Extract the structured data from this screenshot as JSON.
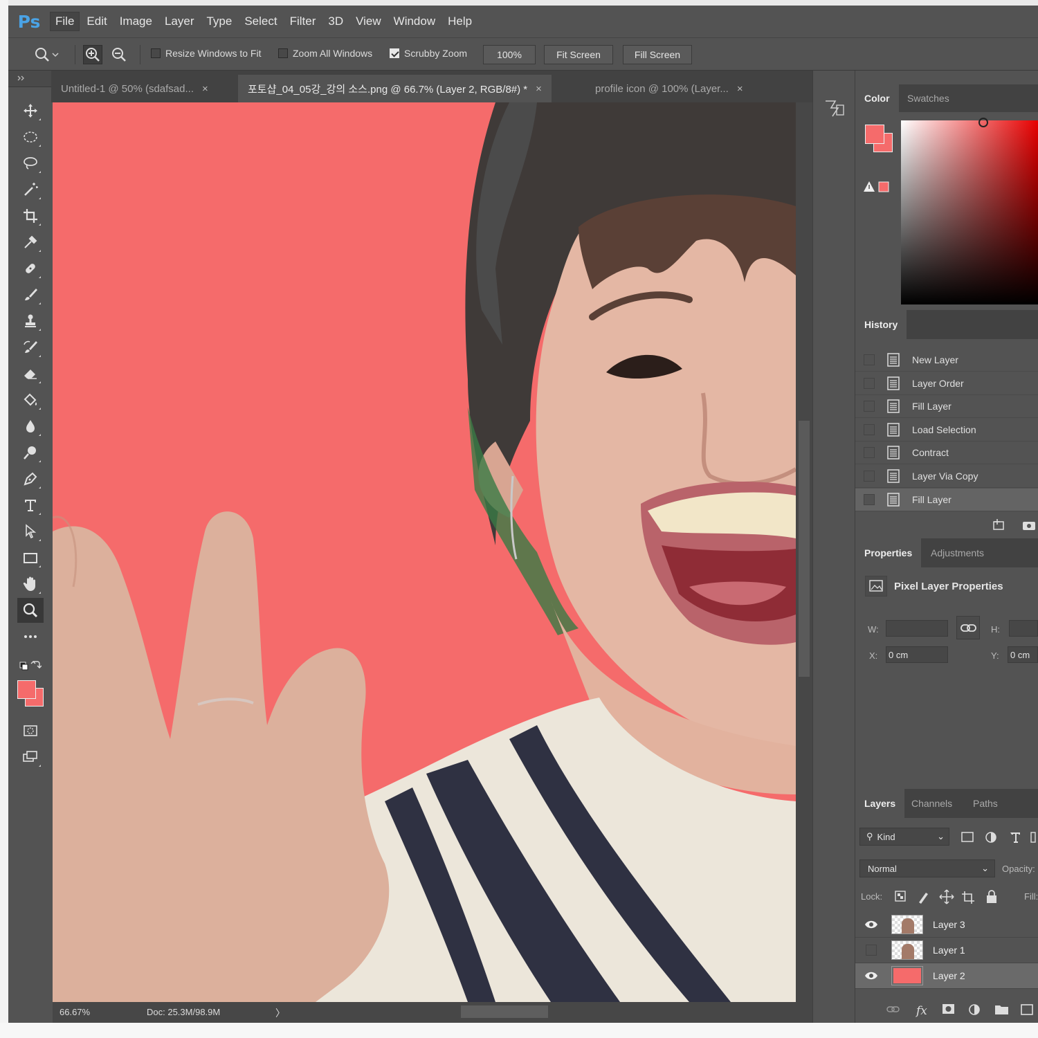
{
  "app": {
    "logo": "Ps"
  },
  "menu": [
    "File",
    "Edit",
    "Image",
    "Layer",
    "Type",
    "Select",
    "Filter",
    "3D",
    "View",
    "Window",
    "Help"
  ],
  "options": {
    "resize_windows": "Resize Windows to Fit",
    "zoom_all": "Zoom All Windows",
    "scrubby_zoom": "Scrubby Zoom",
    "btn_100": "100%",
    "btn_fit": "Fit Screen",
    "btn_fill": "Fill Screen"
  },
  "tabs": [
    {
      "label": "Untitled-1 @ 50% (sdafsad..."
    },
    {
      "label": "포토샵_04_05강_강의 소스.png @ 66.7% (Layer 2, RGB/8#) *"
    },
    {
      "label": "profile icon @ 100% (Layer..."
    }
  ],
  "tab_close": "×",
  "status": {
    "zoom": "66.67%",
    "doc": "Doc: 25.3M/98.9M",
    "arrow": "〉"
  },
  "colors": {
    "foreground": "#f56b6b",
    "background": "#f56b6b",
    "canvas": "#f56b6b"
  },
  "color_panel": {
    "tabs": [
      "Color",
      "Swatches"
    ]
  },
  "history": {
    "title": "History",
    "items": [
      "New Layer",
      "Layer Order",
      "Fill Layer",
      "Load Selection",
      "Contract",
      "Layer Via Copy",
      "Fill Layer"
    ],
    "selected_index": 6
  },
  "properties": {
    "tabs": [
      "Properties",
      "Adjustments"
    ],
    "heading": "Pixel Layer Properties",
    "w_label": "W:",
    "h_label": "H:",
    "x_label": "X:",
    "y_label": "Y:",
    "x_value": "0 cm",
    "y_value": "0 cm"
  },
  "layers": {
    "tabs": [
      "Layers",
      "Channels",
      "Paths"
    ],
    "filter_kind": "Kind",
    "blend_mode": "Normal",
    "opacity_label": "Opacity:",
    "lock_label": "Lock:",
    "fill_label": "Fill:",
    "items": [
      {
        "name": "Layer 3",
        "visible": true,
        "selected": false
      },
      {
        "name": "Layer 1",
        "visible": false,
        "selected": false
      },
      {
        "name": "Layer 2",
        "visible": true,
        "selected": true
      }
    ]
  }
}
